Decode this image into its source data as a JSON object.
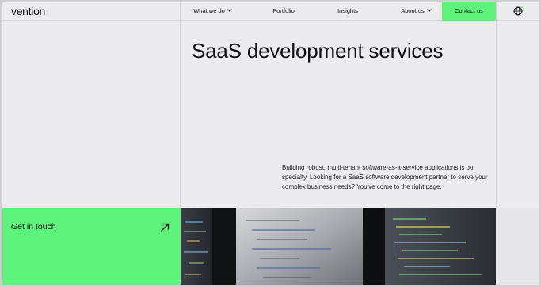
{
  "header": {
    "logo": "vention",
    "nav": [
      {
        "label": "What we do",
        "has_dropdown": true
      },
      {
        "label": "Portfolio",
        "has_dropdown": false
      },
      {
        "label": "Insights",
        "has_dropdown": false
      },
      {
        "label": "About us",
        "has_dropdown": true
      }
    ],
    "contact_label": "Contact us",
    "language_icon": "globe-icon"
  },
  "hero": {
    "title": "SaaS development services",
    "description": "Building robust, multi-tenant software-as-a-service applications is our specialty. Looking for a SaaS software development partner to serve your complex business needs? You've come to the right page."
  },
  "cta": {
    "label": "Get in touch",
    "icon": "arrow-up-right-icon"
  },
  "colors": {
    "accent_green": "#5ef47b",
    "background": "#ecebee"
  }
}
